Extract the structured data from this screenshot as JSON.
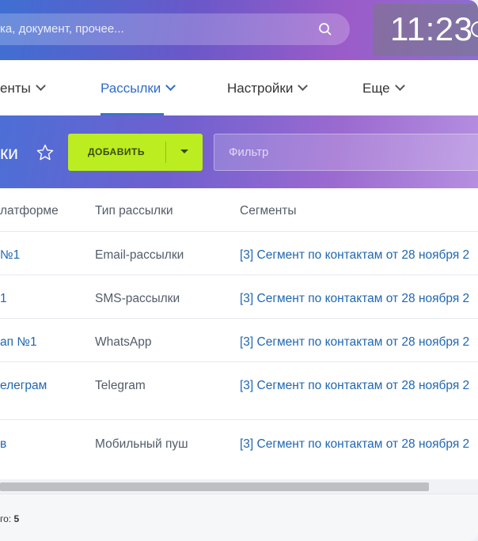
{
  "header": {
    "search_placeholder": "ка, документ, прочее...",
    "clock_time": "11:23"
  },
  "nav": {
    "items": [
      {
        "label": "енты"
      },
      {
        "label": "Рассылки"
      },
      {
        "label": "Настройки"
      },
      {
        "label": "Еще"
      }
    ],
    "active": "Рассылки"
  },
  "titlebar": {
    "title": "ки",
    "add_label": "ДОБАВИТЬ",
    "filter_placeholder": "Фильтр"
  },
  "table": {
    "headers": [
      "латформе",
      "Тип рассылки",
      "Сегменты"
    ],
    "rows": [
      {
        "name": "№1",
        "type": "Email-рассылки",
        "segment": "[3] Сегмент по контактам от 28 ноября 2"
      },
      {
        "name": "1",
        "type": "SMS-рассылки",
        "segment": "[3] Сегмент по контактам от 28 ноября 2"
      },
      {
        "name": "ап №1",
        "type": "WhatsApp",
        "segment": "[3] Сегмент по контактам от 28 ноября 2"
      },
      {
        "name": "елеграм",
        "type": "Telegram",
        "segment": "[3] Сегмент по контактам от 28 ноября 2"
      },
      {
        "name": "в",
        "type": "Мобильный пуш",
        "segment": "[3] Сегмент по контактам от 28 ноября 2"
      }
    ]
  },
  "footer": {
    "total_label": "го:",
    "total_value": "5"
  }
}
